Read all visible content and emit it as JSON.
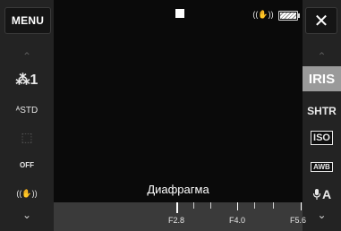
{
  "top_left": {
    "menu_label": "MENU"
  },
  "top_right": {
    "close_glyph": "✕"
  },
  "status": {
    "stabilizer_glyph": "((✋))",
    "battery_icon": "battery-icon"
  },
  "left_panel": {
    "arrow_up": "⌃",
    "arrow_down": "⌄",
    "items": [
      {
        "label": "⁂1",
        "icon": "face-detect-icon"
      },
      {
        "label": "ᴬSTD",
        "icon": "look-std-icon"
      },
      {
        "label": "⬚",
        "icon": "frame-icon"
      },
      {
        "label": "OFF",
        "icon": "self-timer-off-icon"
      },
      {
        "label": "((✋))",
        "icon": "stabilizer-icon"
      }
    ]
  },
  "right_panel": {
    "arrow_up": "⌃",
    "arrow_down": "⌄",
    "items": [
      {
        "label": "IRIS",
        "selected": true
      },
      {
        "label": "SHTR",
        "selected": false
      },
      {
        "label": "ISO",
        "selected": false
      },
      {
        "label": "AWB",
        "selected": false
      },
      {
        "label": "A",
        "icon": "mic-icon",
        "selected": false
      }
    ]
  },
  "aperture": {
    "title": "Диафрагма",
    "scale_labels": [
      "F2.8",
      "F4.0",
      "F5.6"
    ],
    "current_value": "F2.8"
  },
  "colors": {
    "selected_bg": "#9a9a9a",
    "panel_bg": "#232323",
    "scale_bg": "#3a3a3a"
  }
}
